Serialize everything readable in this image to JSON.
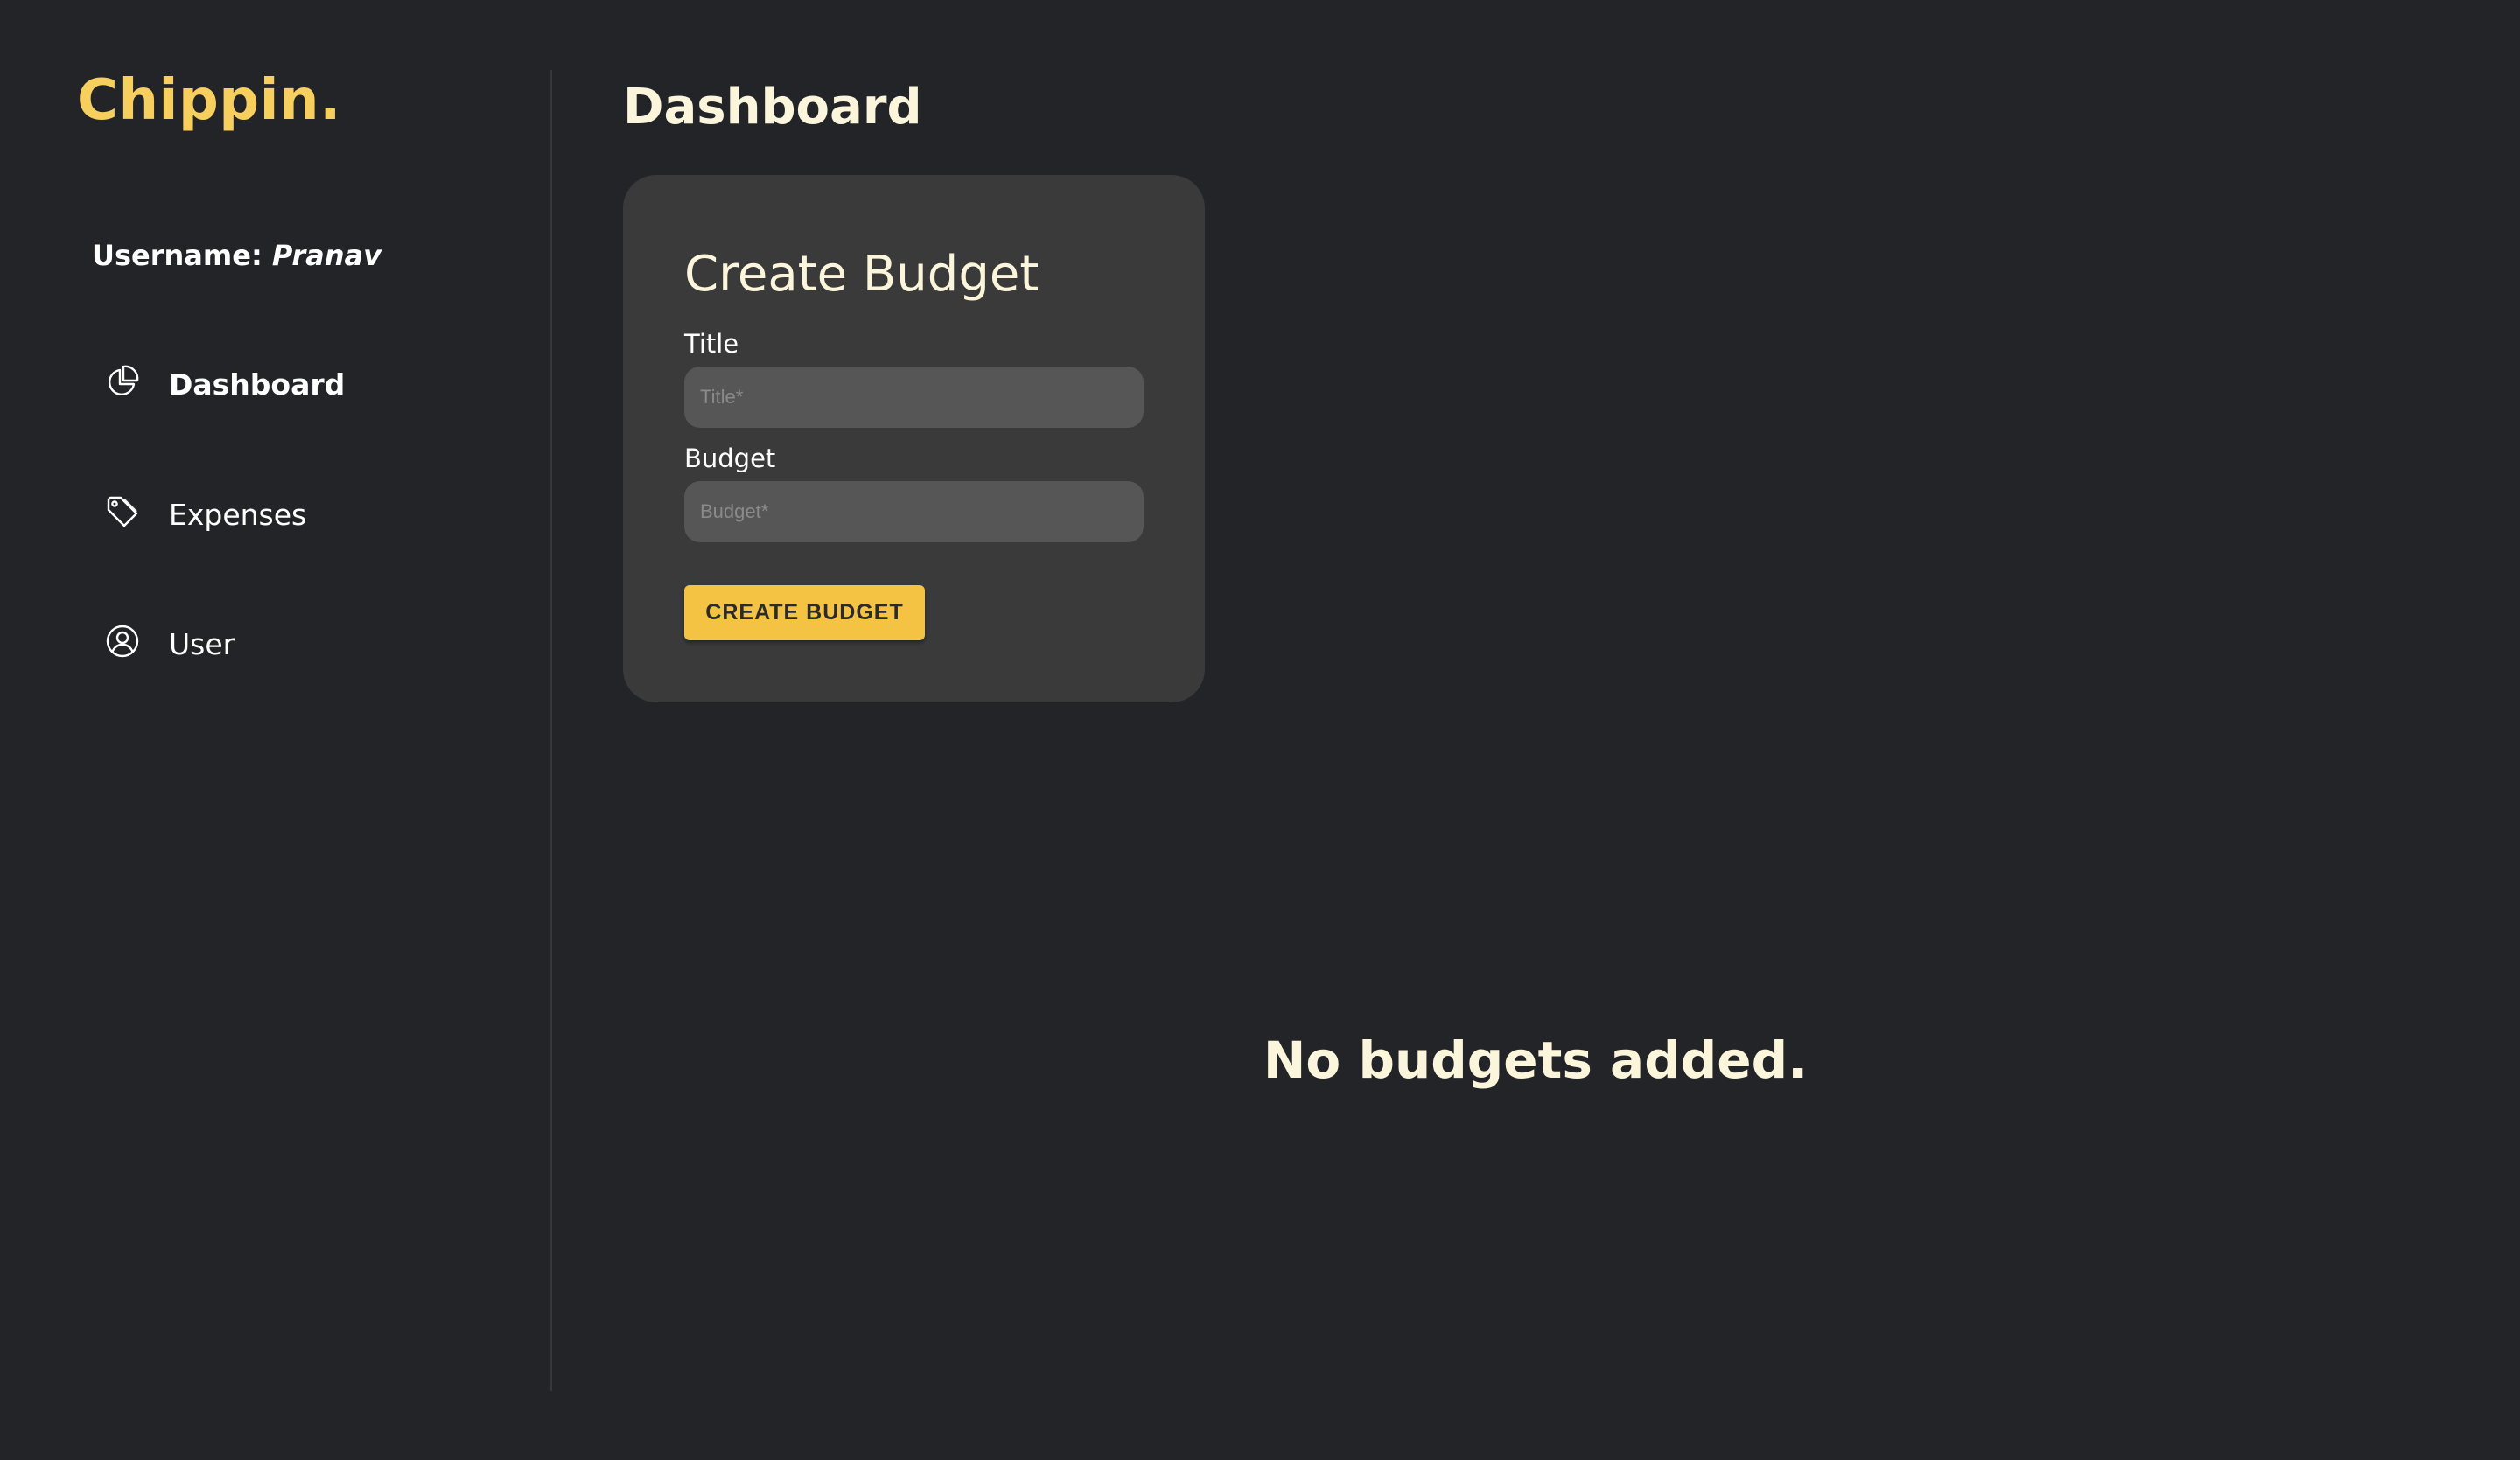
{
  "sidebar": {
    "logo": "Chippin.",
    "username_label": "Username:",
    "username_value": "Pranav",
    "items": [
      {
        "label": "Dashboard",
        "icon": "pie-chart-icon",
        "active": true
      },
      {
        "label": "Expenses",
        "icon": "tag-icon",
        "active": false
      },
      {
        "label": "User",
        "icon": "user-circle-icon",
        "active": false
      }
    ]
  },
  "main": {
    "title": "Dashboard",
    "form": {
      "heading": "Create Budget",
      "title_label": "Title",
      "title_placeholder": "Title*",
      "title_value": "",
      "budget_label": "Budget",
      "budget_placeholder": "Budget*",
      "budget_value": "",
      "submit_label": "CREATE BUDGET"
    },
    "empty_message": "No budgets added."
  },
  "colors": {
    "background": "#232428",
    "accent": "#f7cf5f",
    "button": "#f5c343",
    "card": "#3a3a3a",
    "input": "#565656",
    "heading_text": "#fbf5dc"
  }
}
